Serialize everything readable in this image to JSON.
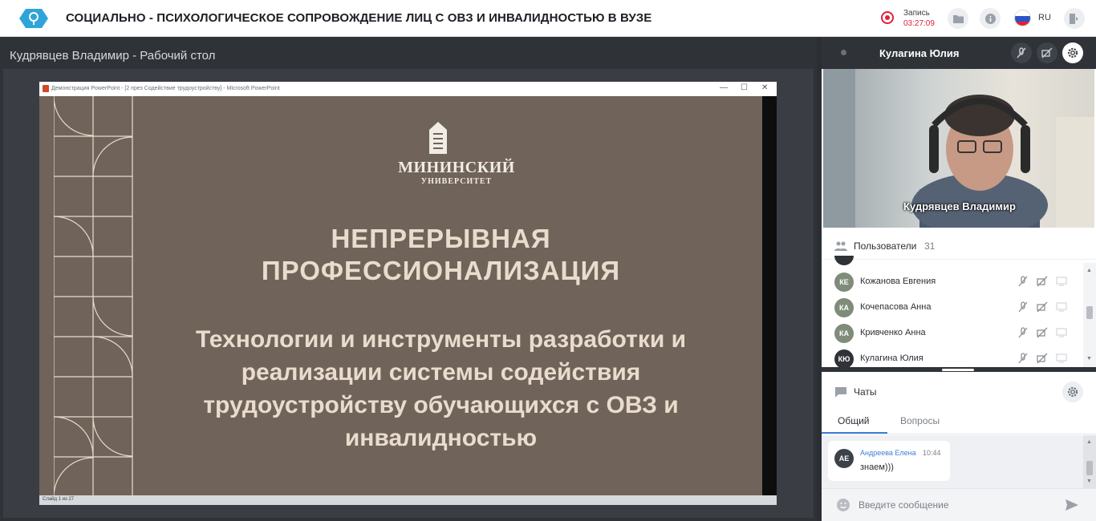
{
  "header": {
    "title": "СОЦИАЛЬНО - ПСИХОЛОГИЧЕСКОЕ СОПРОВОЖДЕНИЕ ЛИЦ С ОВЗ И ИНВАЛИДНОСТЬЮ В ВУЗЕ",
    "record_label": "Запись",
    "record_time": "03:27:09",
    "language": "RU",
    "colors": {
      "record": "#e0203a",
      "logo": "#2fa4d8"
    }
  },
  "desktop": {
    "title": "Кудрявцев Владимир - Рабочий стол",
    "ppt_window_title": "Демонстрация PowerPoint - [2 през Содействие трудоустройству] - Microsoft PowerPoint",
    "ppt_status": "Слайд 1 из 27"
  },
  "slide": {
    "university_name": "МИНИНСКИЙ",
    "university_sub": "УНИВЕРСИТЕТ",
    "heading": "НЕПРЕРЫВНАЯ ПРОФЕССИОНАЛИЗАЦИЯ",
    "subheading": "Технологии и инструменты разработки и реализации системы содействия трудоустройству обучающихся с ОВЗ и инвалидностью",
    "colors": {
      "background": "#706359",
      "text": "#e9dccd"
    }
  },
  "video": {
    "speaker_header": "Кулагина Юлия",
    "camera_name": "Кудрявцев Владимир"
  },
  "users": {
    "label": "Пользователи",
    "count": "31",
    "items": [
      {
        "initials": "КЕ",
        "name": "Кожанова Евгения",
        "color": "#7f8c7a"
      },
      {
        "initials": "КА",
        "name": "Кочепасова Анна",
        "color": "#7f8c7a"
      },
      {
        "initials": "КА",
        "name": "Кривченко Анна",
        "color": "#7f8c7a"
      },
      {
        "initials": "КЮ",
        "name": "Кулагина Юлия",
        "color": "#2f3338"
      }
    ]
  },
  "chats": {
    "label": "Чаты",
    "tabs": [
      "Общий",
      "Вопросы"
    ],
    "messages": [
      {
        "initials": "АЕ",
        "author": "Андреева Елена",
        "time": "10:44",
        "text": "знаем)))"
      }
    ],
    "input_placeholder": "Введите сообщение"
  }
}
